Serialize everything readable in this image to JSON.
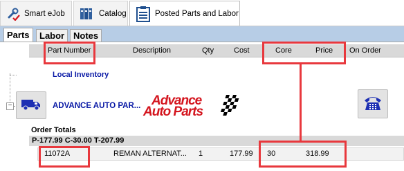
{
  "toolbar": {
    "buttons": [
      {
        "label": "Smart eJob",
        "icon": "wrench-check-icon"
      },
      {
        "label": "Catalog",
        "icon": "catalog-binders-icon"
      },
      {
        "label": "Posted Parts and Labor",
        "icon": "clipboard-list-icon",
        "active": true
      }
    ]
  },
  "tabs": [
    {
      "label": "Parts",
      "active": true
    },
    {
      "label": "Labor",
      "active": false
    },
    {
      "label": "Notes",
      "active": false
    }
  ],
  "columns": {
    "part_number": "Part Number",
    "description": "Description",
    "qty": "Qty",
    "cost": "Cost",
    "core": "Core",
    "price": "Price",
    "on_order": "On Order"
  },
  "tree": {
    "local_inventory": "Local Inventory",
    "vendor_name": "ADVANCE AUTO PAR...",
    "vendor_logo_text": [
      "Advance",
      "Auto Parts"
    ],
    "expander": "⊟"
  },
  "order_totals": {
    "label": "Order Totals",
    "summary": "P-177.99 C-30.00 T-207.99"
  },
  "part_row": {
    "part_number": "11072A",
    "description": "REMAN  ALTERNAT...",
    "qty": "1",
    "cost": "177.99",
    "core": "30",
    "price": "318.99",
    "on_order": ""
  },
  "colors": {
    "band": "#b7cde6",
    "link_blue": "#0a1aa6",
    "highlight_red": "#e8383d",
    "brand_red": "#d4151e"
  }
}
